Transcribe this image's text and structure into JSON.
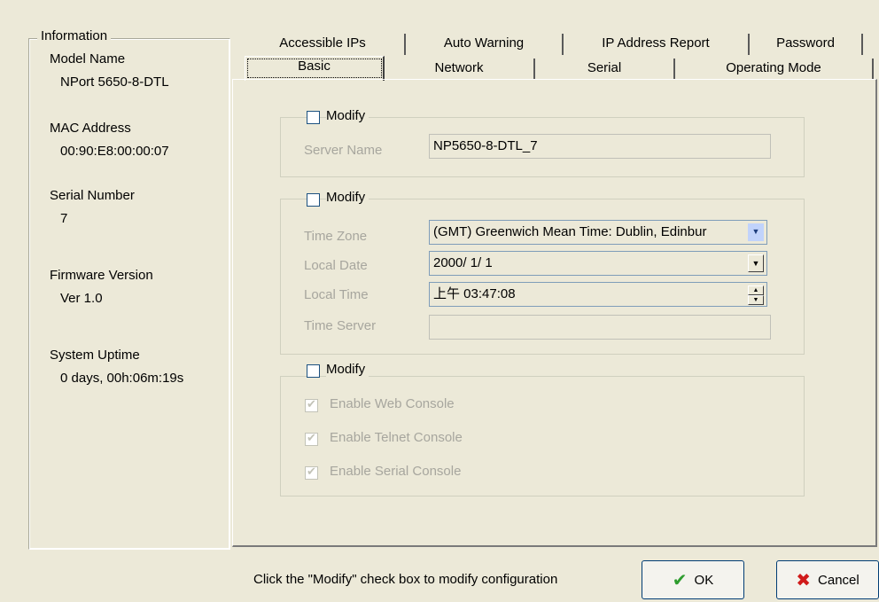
{
  "info": {
    "legend": "Information",
    "model_label": "Model Name",
    "model_value": "NPort 5650-8-DTL",
    "mac_label": "MAC Address",
    "mac_value": "00:90:E8:00:00:07",
    "serial_label": "Serial Number",
    "serial_value": "7",
    "firmware_label": "Firmware Version",
    "firmware_value": "Ver 1.0",
    "uptime_label": "System Uptime",
    "uptime_value": "0 days, 00h:06m:19s"
  },
  "tabs_row1": [
    "Accessible IPs",
    "Auto Warning",
    "IP Address Report",
    "Password"
  ],
  "tabs_row2": [
    "Basic",
    "Network",
    "Serial",
    "Operating Mode"
  ],
  "basic": {
    "group1": {
      "modify": "Modify",
      "server_name_label": "Server Name",
      "server_name_value": "NP5650-8-DTL_7"
    },
    "group2": {
      "modify": "Modify",
      "time_zone_label": "Time Zone",
      "time_zone_value": "(GMT) Greenwich Mean Time: Dublin, Edinbur",
      "local_date_label": "Local Date",
      "local_date_value": "2000/ 1/ 1",
      "local_time_label": "Local Time",
      "local_time_value": "上午 03:47:08",
      "time_server_label": "Time Server",
      "time_server_value": ""
    },
    "group3": {
      "modify": "Modify",
      "web_console": "Enable Web Console",
      "telnet_console": "Enable Telnet Console",
      "serial_console": "Enable Serial Console"
    }
  },
  "footer": {
    "status": "Click the \"Modify\" check box to modify configuration",
    "ok_label": "OK",
    "cancel_label": "Cancel"
  },
  "colors": {
    "ok_check": "#2e9c2e",
    "cancel_x": "#d01a1a"
  }
}
